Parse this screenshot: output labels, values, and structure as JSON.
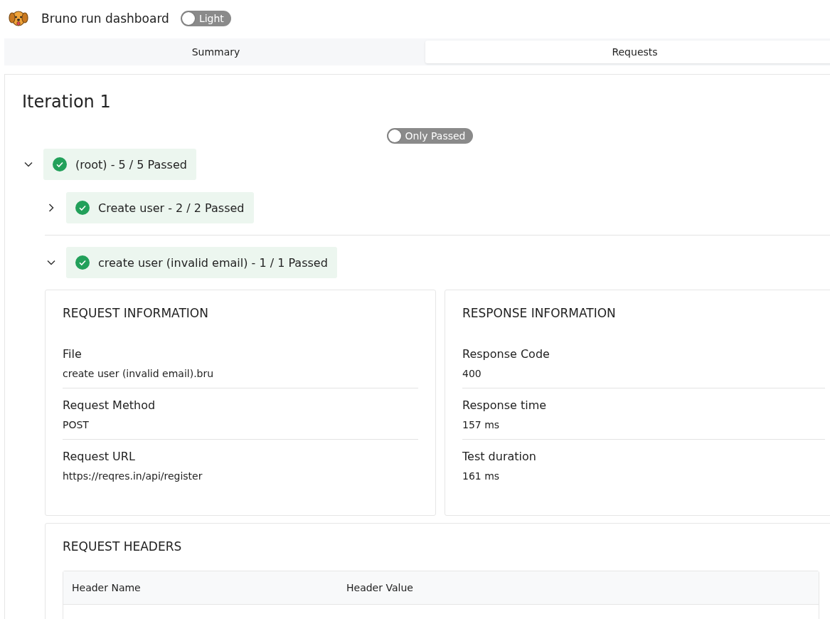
{
  "header": {
    "title": "Bruno run dashboard",
    "theme_toggle": {
      "label": "Light",
      "on": false
    }
  },
  "tabs": [
    {
      "label": "Summary",
      "selected": false
    },
    {
      "label": "Requests",
      "selected": true
    }
  ],
  "iteration": {
    "title": "Iteration 1",
    "filter_toggle": {
      "label": "Only Passed",
      "on": false
    },
    "tree": [
      {
        "label": "(root) - 5 / 5 Passed",
        "passed": true,
        "expanded": true,
        "children": [
          {
            "label": "Create user - 2 / 2 Passed",
            "passed": true,
            "expanded": false
          },
          {
            "label": "create user (invalid email) - 1 / 1 Passed",
            "passed": true,
            "expanded": true,
            "details": {
              "request_information": {
                "title": "REQUEST INFORMATION",
                "fields": [
                  {
                    "label": "File",
                    "value": "create user (invalid email).bru"
                  },
                  {
                    "label": "Request Method",
                    "value": "POST"
                  },
                  {
                    "label": "Request URL",
                    "value": "https://reqres.in/api/register"
                  }
                ]
              },
              "response_information": {
                "title": "RESPONSE INFORMATION",
                "fields": [
                  {
                    "label": "Response Code",
                    "value": "400"
                  },
                  {
                    "label": "Response time",
                    "value": "157 ms"
                  },
                  {
                    "label": "Test duration",
                    "value": "161 ms"
                  }
                ]
              },
              "request_headers": {
                "title": "REQUEST HEADERS",
                "columns": [
                  "Header Name",
                  "Header Value"
                ]
              }
            }
          }
        ]
      }
    ]
  }
}
